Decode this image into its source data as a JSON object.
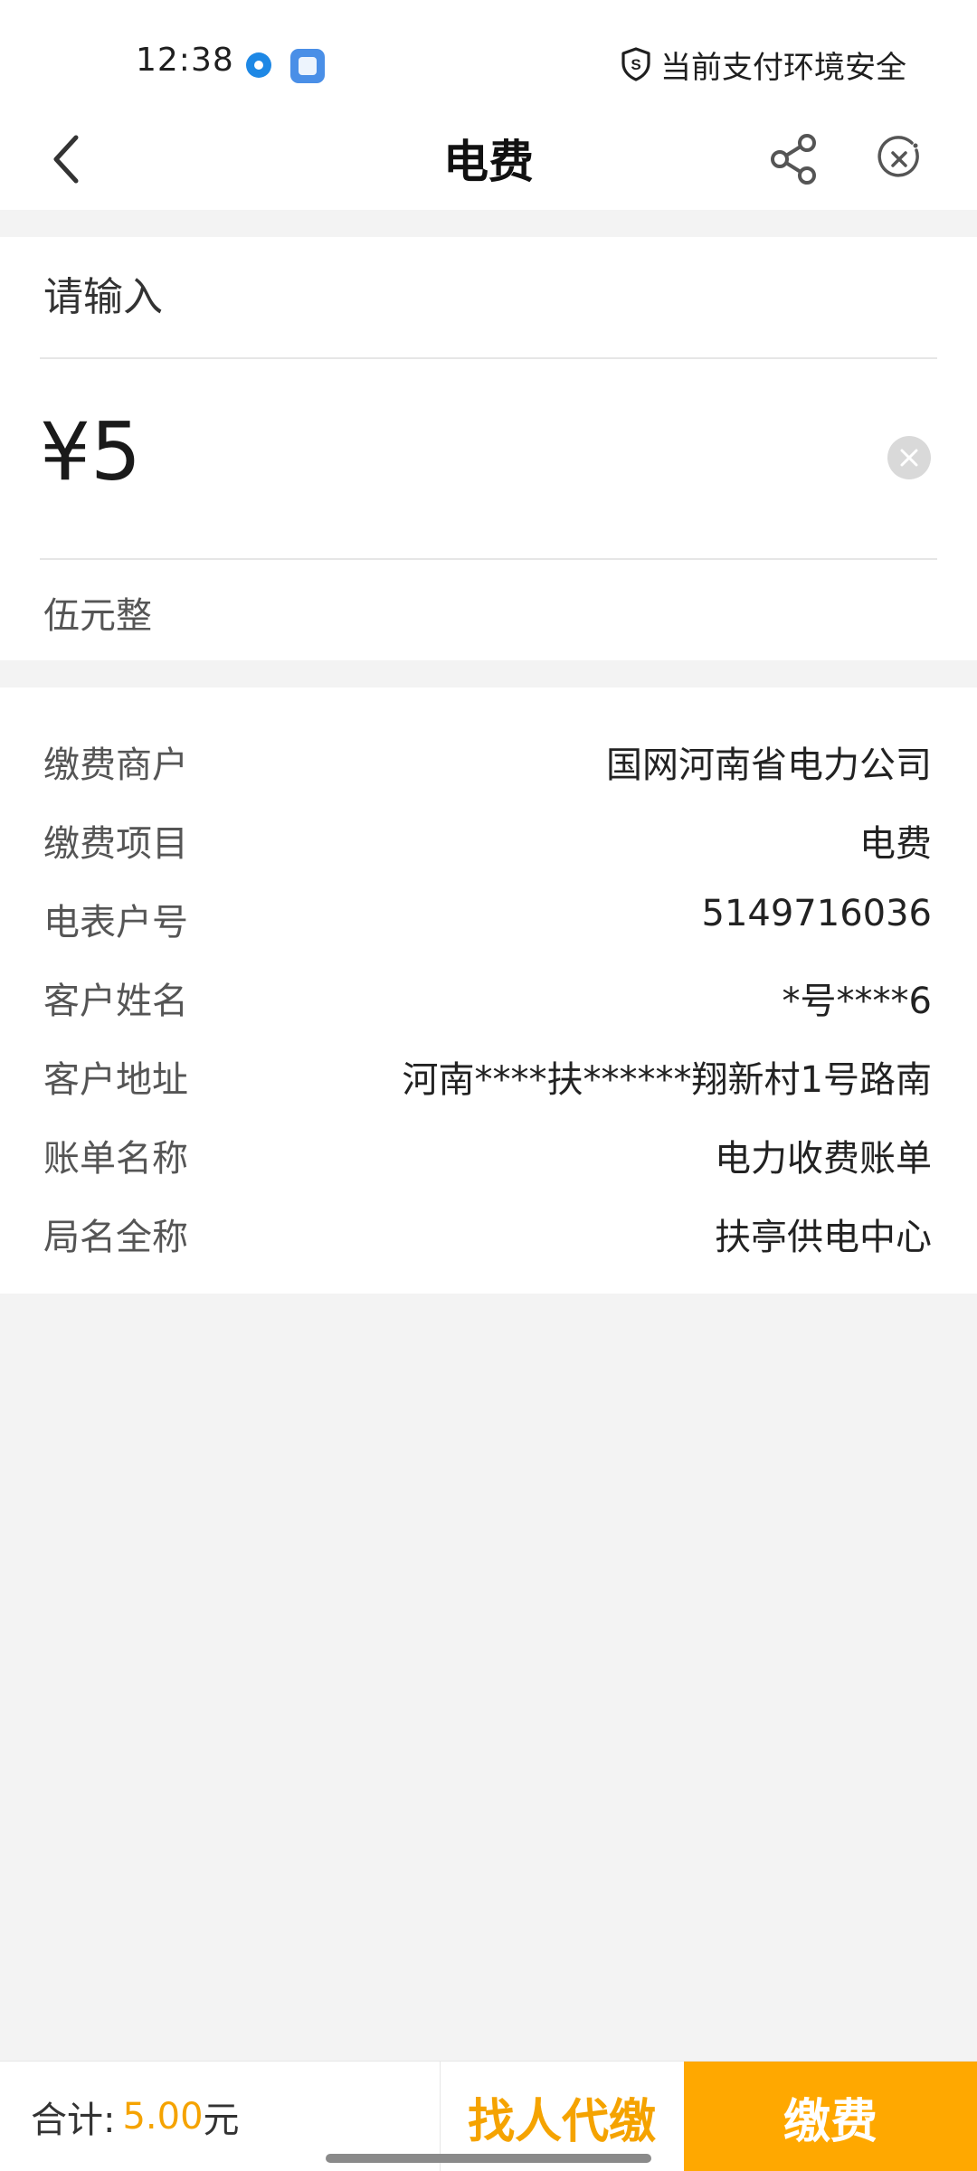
{
  "status_bar": {
    "time": "12:38",
    "secure_text": "当前支付环境安全",
    "icons": [
      "record-dot-icon",
      "app-window-icon",
      "shield-s-icon"
    ]
  },
  "nav": {
    "title": "电费",
    "icons": [
      "chevron-left-icon",
      "share-icon",
      "close-circle-icon"
    ]
  },
  "amount": {
    "label": "请输入",
    "value": "¥5",
    "words": "伍元整"
  },
  "details": [
    {
      "key": "缴费商户",
      "value": "国网河南省电力公司"
    },
    {
      "key": "缴费项目",
      "value": "电费"
    },
    {
      "key": "电表户号",
      "value": "5149716036"
    },
    {
      "key": "客户姓名",
      "value": "*号****6"
    },
    {
      "key": "客户地址",
      "value": "河南****扶******翔新村1号路南"
    },
    {
      "key": "账单名称",
      "value": "电力收费账单"
    },
    {
      "key": "局名全称",
      "value": "扶亭供电中心"
    }
  ],
  "bottom": {
    "total_label": "合计:",
    "total_amount": "5.00",
    "total_unit": "元",
    "proxy_label": "找人代缴",
    "pay_label": "缴费"
  },
  "colors": {
    "accent": "#ffa800",
    "accent_text": "#f5a300",
    "background": "#f3f3f3"
  }
}
